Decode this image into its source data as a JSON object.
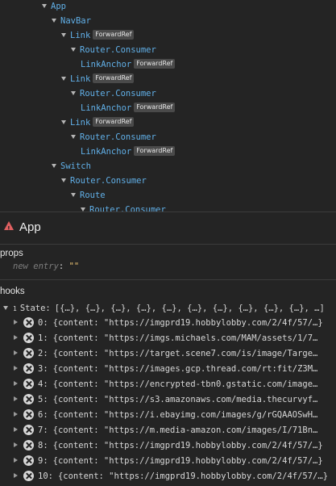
{
  "tree": [
    {
      "name": "App",
      "depth": 0
    },
    {
      "name": "NavBar",
      "depth": 1
    },
    {
      "name": "Link",
      "depth": 2,
      "badge": "ForwardRef"
    },
    {
      "name": "Router.Consumer",
      "depth": 3
    },
    {
      "name": "LinkAnchor",
      "depth": 3,
      "badge": "ForwardRef",
      "leaf": true
    },
    {
      "name": "Link",
      "depth": 2,
      "badge": "ForwardRef"
    },
    {
      "name": "Router.Consumer",
      "depth": 3
    },
    {
      "name": "LinkAnchor",
      "depth": 3,
      "badge": "ForwardRef",
      "leaf": true
    },
    {
      "name": "Link",
      "depth": 2,
      "badge": "ForwardRef"
    },
    {
      "name": "Router.Consumer",
      "depth": 3
    },
    {
      "name": "LinkAnchor",
      "depth": 3,
      "badge": "ForwardRef",
      "leaf": true
    },
    {
      "name": "Switch",
      "depth": 1
    },
    {
      "name": "Router.Consumer",
      "depth": 2
    },
    {
      "name": "Route",
      "depth": 3
    },
    {
      "name": "Router.Consumer",
      "depth": 4
    }
  ],
  "selected": {
    "title": "App",
    "icon": "warning-icon"
  },
  "props": {
    "label": "props",
    "entry_key": "new entry",
    "entry_sep": ":",
    "entry_value": "\"\""
  },
  "hooks": {
    "label": "hooks",
    "state_number": "1",
    "state_label": "State:",
    "state_value": "[{…}, {…}, {…}, {…}, {…}, {…}, {…}, {…}, {…}, {…}, …]",
    "items": [
      {
        "index": "0:",
        "value": "{content: \"https://imgprd19.hobbylobby.com/2/4f/57/…}"
      },
      {
        "index": "1:",
        "value": "{content: \"https://imgs.michaels.com/MAM/assets/1/7…"
      },
      {
        "index": "2:",
        "value": "{content: \"https://target.scene7.com/is/image/Targe…"
      },
      {
        "index": "3:",
        "value": "{content: \"https://images.gcp.thread.com/rt:fit/Z3M…"
      },
      {
        "index": "4:",
        "value": "{content: \"https://encrypted-tbn0.gstatic.com/image…"
      },
      {
        "index": "5:",
        "value": "{content: \"https://s3.amazonaws.com/media.thecurvyf…"
      },
      {
        "index": "6:",
        "value": "{content: \"https://i.ebayimg.com/images/g/rGQAAOSwH…"
      },
      {
        "index": "7:",
        "value": "{content: \"https://m.media-amazon.com/images/I/71Bn…"
      },
      {
        "index": "8:",
        "value": "{content: \"https://imgprd19.hobbylobby.com/2/4f/57/…}"
      },
      {
        "index": "9:",
        "value": "{content: \"https://imgprd19.hobbylobby.com/2/4f/57/…}"
      },
      {
        "index": "10:",
        "value": "{content: \"https://imgprd19.hobbylobby.com/2/4f/57/…}"
      }
    ]
  },
  "colors": {
    "component": "#61b0e8",
    "warning": "#e06061",
    "string": "#f0c674",
    "background": "#242424"
  }
}
